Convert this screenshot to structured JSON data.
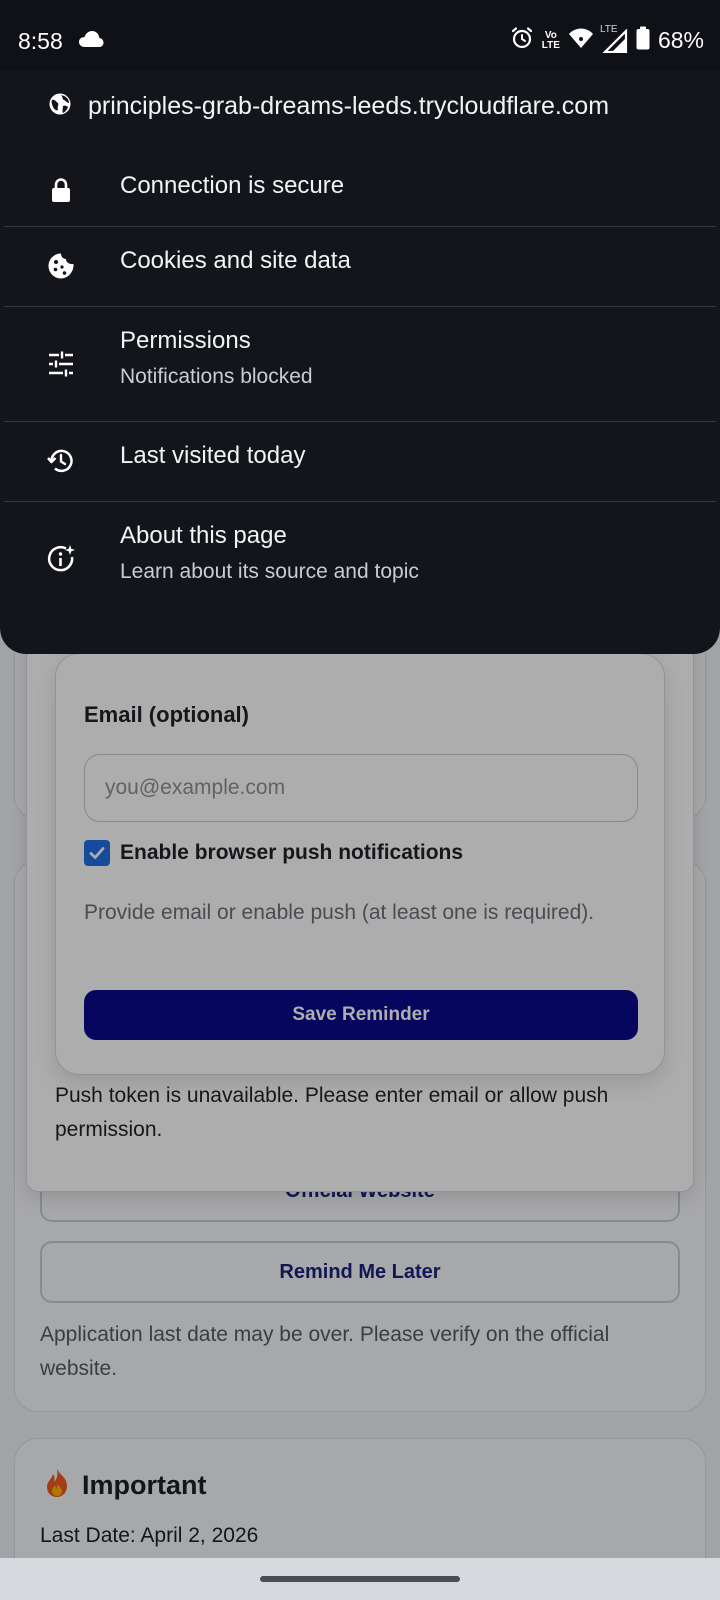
{
  "status_bar": {
    "time": "8:58",
    "battery": "68%",
    "volte_top": "Vo",
    "volte_bottom": "LTE",
    "lte": "LTE"
  },
  "site_info": {
    "url": "principles-grab-dreams-leeds.trycloudflare.com",
    "items": [
      {
        "icon": "lock-icon",
        "title": "Connection is secure"
      },
      {
        "icon": "cookie-icon",
        "title": "Cookies and site data"
      },
      {
        "icon": "tune-icon",
        "title": "Permissions",
        "subtitle": "Notifications blocked"
      },
      {
        "icon": "history-icon",
        "title": "Last visited today"
      },
      {
        "icon": "info-sparkle-icon",
        "title": "About this page",
        "subtitle": "Learn about its source and topic"
      }
    ]
  },
  "reminder_dialog": {
    "email_label": "Email (optional)",
    "email_placeholder": "you@example.com",
    "email_value": "",
    "push_label": "Enable browser push notifications",
    "push_checked": true,
    "hint": "Provide email or enable push (at least one is required).",
    "save_label": "Save Reminder",
    "token_message": "Push token is unavailable. Please enter email or allow push permission."
  },
  "page": {
    "official_label": "Official Website",
    "remind_label": "Remind Me Later",
    "warning": "Application last date may be over. Please verify on the official website.",
    "important_title": "Important",
    "last_date": "Last Date: April 2, 2026"
  },
  "colors": {
    "sheet_bg": "#13151b",
    "save_button": "#0a0a8c",
    "checkbox": "#1f6fe5"
  }
}
